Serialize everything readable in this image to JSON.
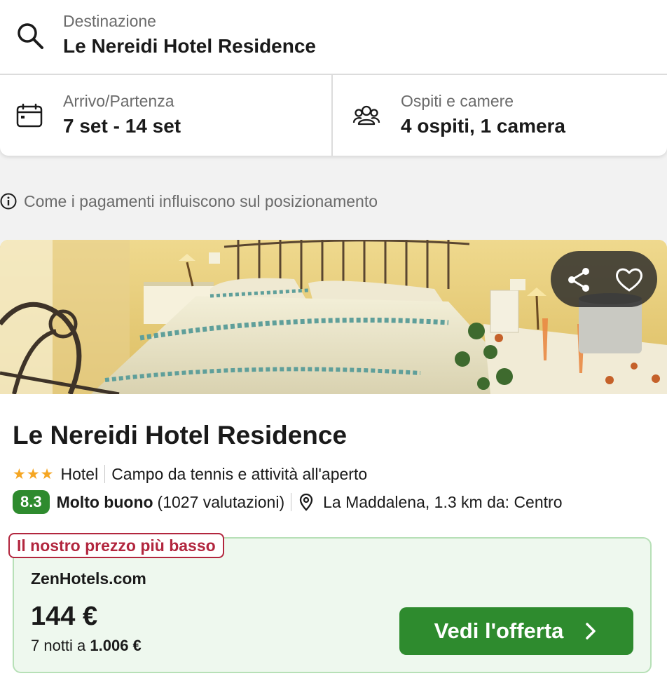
{
  "search": {
    "destination_label": "Destinazione",
    "destination_value": "Le Nereidi Hotel Residence",
    "dates_label": "Arrivo/Partenza",
    "dates_value": "7 set - 14 set",
    "guests_label": "Ospiti e camere",
    "guests_value": "4 ospiti, 1 camera"
  },
  "payments_note": "Come i pagamenti influiscono sul posizionamento",
  "hotel": {
    "name": "Le Nereidi Hotel Residence",
    "stars": "★★★",
    "star_count": 3,
    "type": "Hotel",
    "feature": "Campo da tennis e attività all'aperto",
    "rating_score": "8.3",
    "rating_label": "Molto buono",
    "reviews": "(1027 valutazioni)",
    "location": "La Maddalena, 1.3 km da: Centro"
  },
  "deal": {
    "tag": "Il nostro prezzo più basso",
    "provider": "ZenHotels.com",
    "price": "144 €",
    "nights_prefix": "7 notti a ",
    "total": "1.006 €",
    "button_label": "Vedi l'offerta"
  },
  "colors": {
    "rating_green": "#2e8b2e",
    "deal_tag_red": "#b2263e",
    "deal_bg": "#eef8ee",
    "star_orange": "#f5a623"
  },
  "icons": {
    "destination": "search-icon",
    "dates": "calendar-icon",
    "guests": "people-icon",
    "note": "info-icon",
    "share": "share-icon",
    "favorite": "heart-icon",
    "location": "map-pin-icon",
    "button": "chevron-right-icon"
  }
}
